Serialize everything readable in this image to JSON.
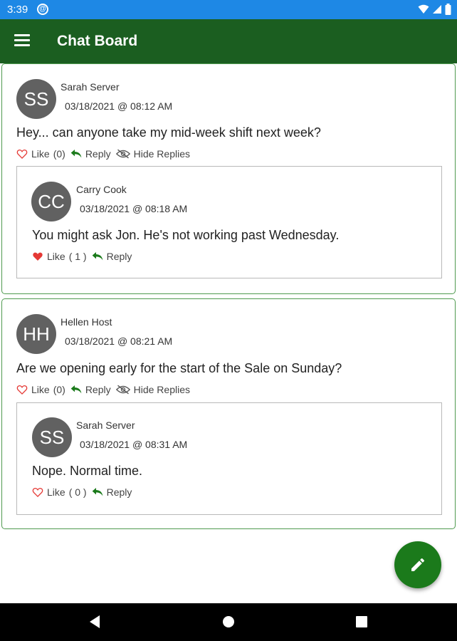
{
  "status_bar": {
    "time": "3:39",
    "notification_icon": "at-sign-icon",
    "icons": [
      "wifi-icon",
      "signal-icon",
      "battery-icon"
    ]
  },
  "app_bar": {
    "title": "Chat Board",
    "menu_icon": "menu-icon"
  },
  "posts": [
    {
      "author": "Sarah Server",
      "initials": "SS",
      "timestamp": "03/18/2021 @ 08:12 AM",
      "message": "Hey... can anyone take my mid-week shift next week?",
      "like_label": "Like",
      "like_count": "(0)",
      "liked": false,
      "reply_label": "Reply",
      "hide_replies_label": "Hide Replies",
      "replies": [
        {
          "author": "Carry Cook",
          "initials": "CC",
          "timestamp": "03/18/2021 @ 08:18 AM",
          "message": "You might ask Jon.  He's not working past Wednesday.",
          "like_label": "Like",
          "like_count": "( 1 )",
          "liked": true,
          "reply_label": "Reply"
        }
      ]
    },
    {
      "author": "Hellen Host",
      "initials": "HH",
      "timestamp": "03/18/2021 @ 08:21 AM",
      "message": "Are we opening early for the start of the Sale on Sunday?",
      "like_label": "Like",
      "like_count": "(0)",
      "liked": false,
      "reply_label": "Reply",
      "hide_replies_label": "Hide Replies",
      "replies": [
        {
          "author": "Sarah Server",
          "initials": "SS",
          "timestamp": "03/18/2021 @ 08:31 AM",
          "message": "Nope.  Normal time.",
          "like_label": "Like",
          "like_count": "( 0 )",
          "liked": false,
          "reply_label": "Reply"
        }
      ]
    }
  ],
  "fab": {
    "icon": "pencil-icon"
  },
  "nav_bar": {
    "icons": [
      "back-icon",
      "home-icon",
      "recents-icon"
    ]
  },
  "colors": {
    "status_bar": "#1e88e5",
    "app_bar": "#1b5e20",
    "post_border": "#4f9a4f",
    "accent": "#1b7a1b",
    "like_red": "#e53935"
  }
}
